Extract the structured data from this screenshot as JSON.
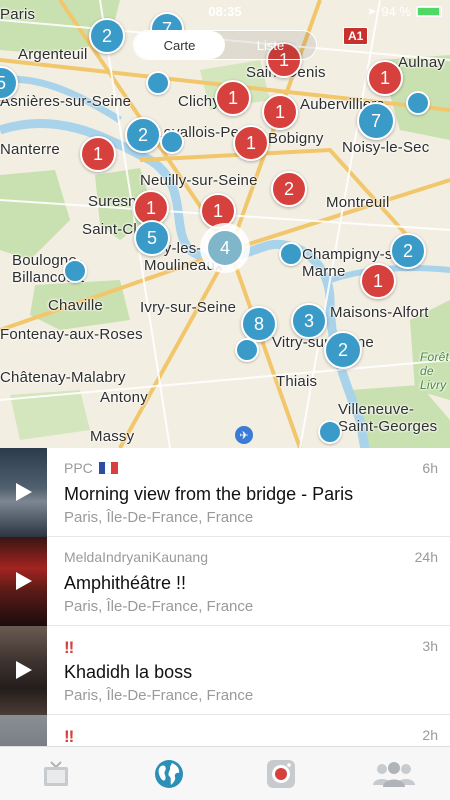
{
  "status_bar": {
    "time": "08:35",
    "battery": "94 %",
    "battery_level": 0.94
  },
  "segment": {
    "map_label": "Carte",
    "list_label": "Liste",
    "selected": "map"
  },
  "map": {
    "road_sign": "A1",
    "places": [
      "Paris",
      "Argenteuil",
      "Saint-Denis",
      "Aulnay",
      "Asnières-sur-Seine",
      "Clichy",
      "Aubervilliers",
      "Noisy-le-Sec",
      "Nanterre",
      "Levallois-Perret",
      "Bobigny",
      "Neuilly-sur-Seine",
      "Montreuil",
      "Suresnes",
      "Saint-Cloud",
      "Boulogne-Billancourt",
      "Issy-les-Moulineaux",
      "Champigny-sur-Marne",
      "Chaville",
      "Ivry-sur-Seine",
      "Maisons-Alfort",
      "Fontenay-aux-Roses",
      "Vitry-sur-Seine",
      "Châtenay-Malabry",
      "Thiais",
      "Antony",
      "Villeneuve-Saint-Georges",
      "Massy",
      "Forêt de Livry"
    ],
    "clusters": [
      {
        "count": "2",
        "color": "blue"
      },
      {
        "count": "7",
        "color": "blue"
      },
      {
        "count": "1",
        "color": "red"
      },
      {
        "count": "1",
        "color": "red"
      },
      {
        "count": "5",
        "color": "blue"
      },
      {
        "count": "1",
        "color": "red"
      },
      {
        "count": "1",
        "color": "red"
      },
      {
        "count": "2",
        "color": "blue"
      },
      {
        "count": "7",
        "color": "blue"
      },
      {
        "count": "1",
        "color": "red"
      },
      {
        "count": "1",
        "color": "red"
      },
      {
        "count": "2",
        "color": "red"
      },
      {
        "count": "1",
        "color": "red"
      },
      {
        "count": "1",
        "color": "red"
      },
      {
        "count": "5",
        "color": "blue"
      },
      {
        "count": "4",
        "color": "selected"
      },
      {
        "count": "2",
        "color": "blue"
      },
      {
        "count": "1",
        "color": "red"
      },
      {
        "count": "8",
        "color": "blue"
      },
      {
        "count": "3",
        "color": "blue"
      },
      {
        "count": "2",
        "color": "blue"
      }
    ]
  },
  "feed": [
    {
      "user": "PPC",
      "flag": "france",
      "time": "6h",
      "title": "Morning view from the bridge - Paris",
      "location": "Paris, Île-De-France, France"
    },
    {
      "user": "MeldaIndryaniKaunang",
      "time": "24h",
      "title": "Amphithéâtre !!",
      "location": "Paris, Île-De-France, France"
    },
    {
      "user": "‼",
      "time": "3h",
      "title": "Khadidh la boss",
      "location": "Paris, Île-De-France, France"
    },
    {
      "user": "‼",
      "time": "2h"
    }
  ],
  "tabs": [
    {
      "icon": "tv-icon",
      "active": false
    },
    {
      "icon": "globe-icon",
      "active": true
    },
    {
      "icon": "camera-icon",
      "active": false
    },
    {
      "icon": "people-icon",
      "active": false
    }
  ],
  "colors": {
    "accent": "#3a9bc9",
    "red_cluster": "#d6413d",
    "tab_active": "#2b8fb8",
    "tab_inactive": "#b0b4b8"
  }
}
